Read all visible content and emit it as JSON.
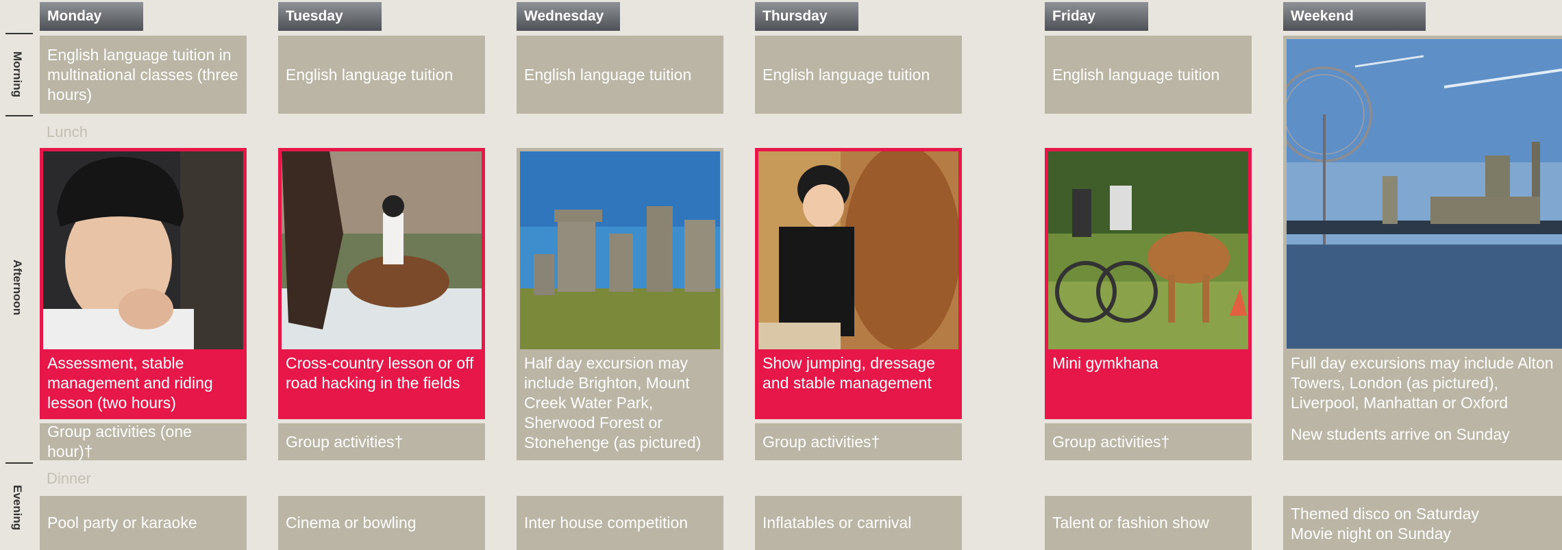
{
  "days": [
    {
      "name": "Monday"
    },
    {
      "name": "Tuesday"
    },
    {
      "name": "Wednesday"
    },
    {
      "name": "Thursday"
    },
    {
      "name": "Friday"
    },
    {
      "name": "Weekend"
    }
  ],
  "sections": {
    "morning": "Morning",
    "afternoon": "Afternoon",
    "evening": "Evening"
  },
  "meals": {
    "lunch": "Lunch",
    "dinner": "Dinner"
  },
  "morning": [
    "English language tuition in multinational classes (three hours)",
    "English language tuition",
    "English language tuition",
    "English language tuition",
    "English language tuition"
  ],
  "afternoon": [
    {
      "caption": "Assessment, stable management and riding lesson (two hours)",
      "photo": "rider-helmet-photo",
      "group": "Group activities (one hour)†"
    },
    {
      "caption": "Cross-country lesson or off road hacking in the fields",
      "photo": "horse-water-photo",
      "group": "Group activities†"
    },
    {
      "caption": "Half day excursion may include Brighton, Mount Creek Water Park, Sherwood Forest or Stonehenge (as pictured)",
      "photo": "stonehenge-photo"
    },
    {
      "caption": "Show jumping, dressage and stable management",
      "photo": "girl-horse-photo",
      "group": "Group activities†"
    },
    {
      "caption": "Mini gymkhana",
      "photo": "horse-cart-photo",
      "group": "Group activities†"
    },
    {
      "caption": "Full day excursions may include Alton Towers, London (as pictured), Liverpool, Manhattan or Oxford",
      "note": "New students arrive on Sunday",
      "photo": "london-eye-photo"
    }
  ],
  "evening": [
    "Pool party or karaoke",
    "Cinema or bowling",
    "Inter house competition",
    "Inflatables or carnival",
    "Talent or fashion show"
  ],
  "weekend_evening": [
    "Themed disco on Saturday",
    "Movie night on Sunday"
  ],
  "colors": {
    "accent": "#e8174a",
    "cell": "#bab5a4",
    "background": "#e8e5de"
  }
}
